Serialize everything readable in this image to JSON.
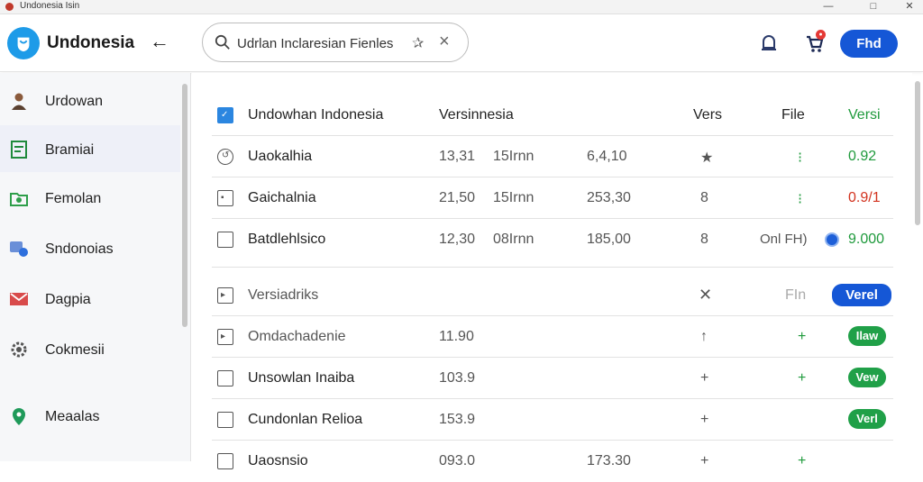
{
  "window": {
    "title": "Undonesia Isin"
  },
  "header": {
    "brand": "Undonesia",
    "search_value": "Udrlan Inclaresian Fienles",
    "button_label": "Fhd"
  },
  "sidebar": {
    "items": [
      {
        "label": "Urdowan",
        "icon": "person-icon"
      },
      {
        "label": "Bramiai",
        "icon": "document-icon"
      },
      {
        "label": "Femolan",
        "icon": "folder-icon"
      },
      {
        "label": "Sndonoias",
        "icon": "cloud-icon"
      },
      {
        "label": "Dagpia",
        "icon": "mail-icon"
      },
      {
        "label": "Cokmesii",
        "icon": "gear-icon"
      },
      {
        "label": "Meaalas",
        "icon": "location-icon"
      }
    ]
  },
  "table": {
    "header": {
      "name": "Undowhan Indonesia",
      "col2": "Versinnesia",
      "col3": "Vers",
      "col4": "File",
      "col5": "Versi"
    },
    "rows": [
      {
        "name": "Uaokalhia",
        "a": "13,31",
        "b": "15Irnn",
        "c": "6,4,10",
        "d": "★",
        "e": "⁝",
        "f": "0.92",
        "f_color": "green"
      },
      {
        "name": "Gaichalnia",
        "a": "21,50",
        "b": "15Irnn",
        "c": "253,30",
        "d": "8",
        "e": "⁝",
        "f": "0.9/1",
        "f_color": "red"
      },
      {
        "name": "Batdlehlsico",
        "a": "12,30",
        "b": "08Irnn",
        "c": "185,00",
        "d": "8",
        "e": "Onl FH)",
        "f": "9.000",
        "f_color": "green"
      }
    ],
    "section2_header": {
      "name": "Versiadriks",
      "x": "✕",
      "fin": "FIn",
      "button": "Verel"
    },
    "rows2": [
      {
        "name": "Omdachadenie",
        "a": "11.90",
        "d": "↑",
        "e": "+",
        "badge": "Ilaw"
      },
      {
        "name": "Unsowlan Inaiba",
        "a": "103.9",
        "d": "+",
        "e": "+",
        "badge": "Vew"
      },
      {
        "name": "Cundonlan Relioa",
        "a": "153.9",
        "d": "+",
        "e": "",
        "badge": "Verl"
      },
      {
        "name": "Uaosnsio",
        "a": "093.0",
        "c": "173.30",
        "d": "+",
        "e": "+",
        "badge": ""
      }
    ]
  },
  "colors": {
    "accent": "#1557d6",
    "logo": "#1e9be8",
    "green": "#1f9a3c",
    "red": "#d2321e"
  }
}
